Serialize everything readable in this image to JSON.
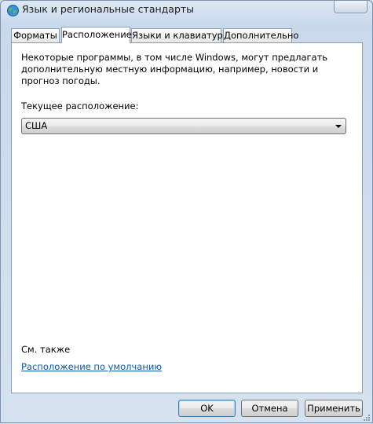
{
  "window": {
    "title": "Язык и региональные стандарты"
  },
  "tabs": [
    {
      "label": "Форматы",
      "active": false
    },
    {
      "label": "Расположение",
      "active": true
    },
    {
      "label": "Языки и клавиатуры",
      "active": false
    },
    {
      "label": "Дополнительно",
      "active": false
    }
  ],
  "location_tab": {
    "description": "Некоторые программы, в том числе Windows, могут предлагать дополнительную местную информацию, например, новости и прогноз погоды.",
    "current_location_label": "Текущее расположение:",
    "current_location_value": "США",
    "see_also_label": "См. также",
    "default_location_link": "Расположение по умолчанию"
  },
  "buttons": {
    "ok": "OK",
    "cancel": "Отмена",
    "apply": "Применить"
  },
  "colors": {
    "link": "#0a5ab0",
    "frame": "#cfdcec"
  }
}
